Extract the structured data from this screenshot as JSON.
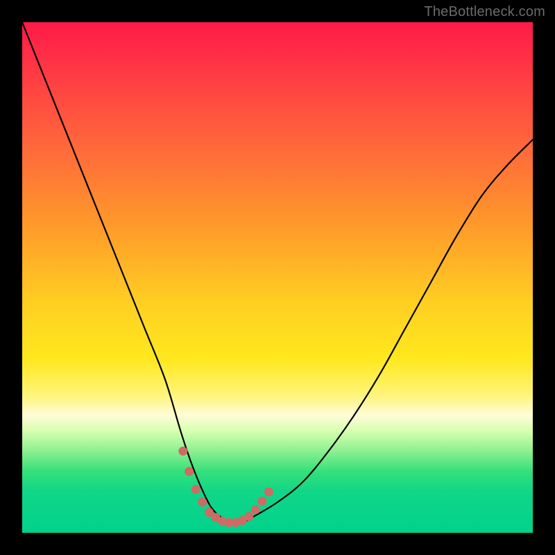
{
  "watermark": "TheBottleneck.com",
  "chart_data": {
    "type": "line",
    "title": "",
    "xlabel": "",
    "ylabel": "",
    "xlim": [
      0,
      100
    ],
    "ylim": [
      0,
      100
    ],
    "series": [
      {
        "name": "bottleneck-curve",
        "x": [
          0,
          4,
          8,
          12,
          16,
          20,
          24,
          28,
          31,
          33,
          35,
          37,
          39,
          41,
          43,
          45,
          50,
          55,
          60,
          65,
          70,
          75,
          80,
          85,
          90,
          95,
          100
        ],
        "values": [
          100,
          90,
          80,
          70,
          60,
          50,
          40,
          30,
          20,
          14,
          9,
          5,
          3,
          2,
          2,
          3,
          6,
          10,
          16,
          23,
          31,
          40,
          49,
          58,
          66,
          72,
          77
        ]
      }
    ],
    "highlight": {
      "name": "min-region-dots",
      "x": [
        31.5,
        32.7,
        34.0,
        35.3,
        36.6,
        37.9,
        39.2,
        40.5,
        41.8,
        43.1,
        44.4,
        45.7,
        47.0,
        48.3
      ],
      "values": [
        16.0,
        12.0,
        8.5,
        6.0,
        4.0,
        3.0,
        2.3,
        2.0,
        2.0,
        2.4,
        3.2,
        4.5,
        6.2,
        8.0
      ]
    },
    "background_gradient": {
      "top": "#ff1a48",
      "mid": "#ffe81e",
      "bottom": "#00d28c"
    }
  }
}
